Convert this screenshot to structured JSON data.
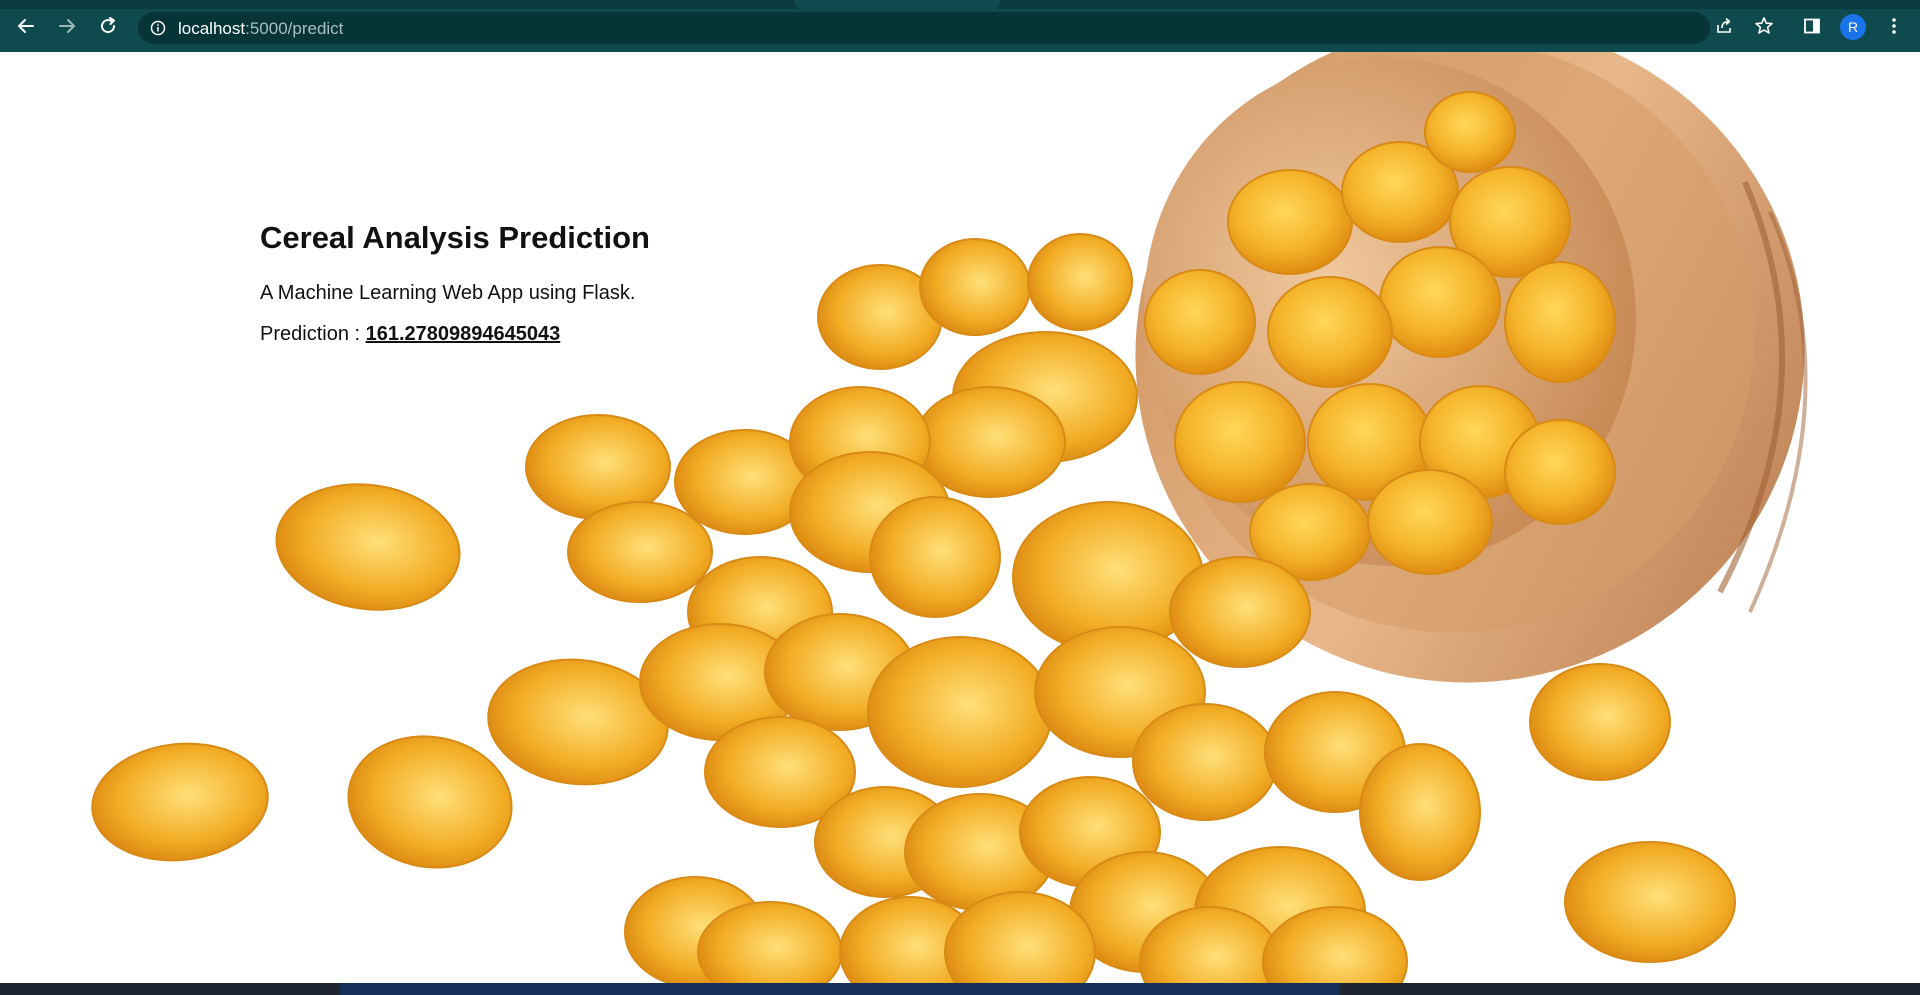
{
  "browser": {
    "url_host": "localhost",
    "url_path": ":5000/predict",
    "profile_initial": "R",
    "icons": {
      "back": "arrow-left-icon",
      "forward": "arrow-right-icon",
      "reload": "reload-icon",
      "info": "info-icon",
      "share": "share-icon",
      "bookmark": "star-icon",
      "side_panel": "side-panel-icon",
      "menu": "kebab-menu-icon"
    },
    "colors": {
      "chrome": "#0e4a4e",
      "omnibox": "#073437",
      "avatar": "#1a73e8"
    }
  },
  "page": {
    "title": "Cereal Analysis Prediction",
    "subtitle": "A Machine Learning Web App using Flask.",
    "prediction_label": "Prediction : ",
    "prediction_value": "161.27809894645043",
    "background": "cornflakes-bowl-image"
  }
}
